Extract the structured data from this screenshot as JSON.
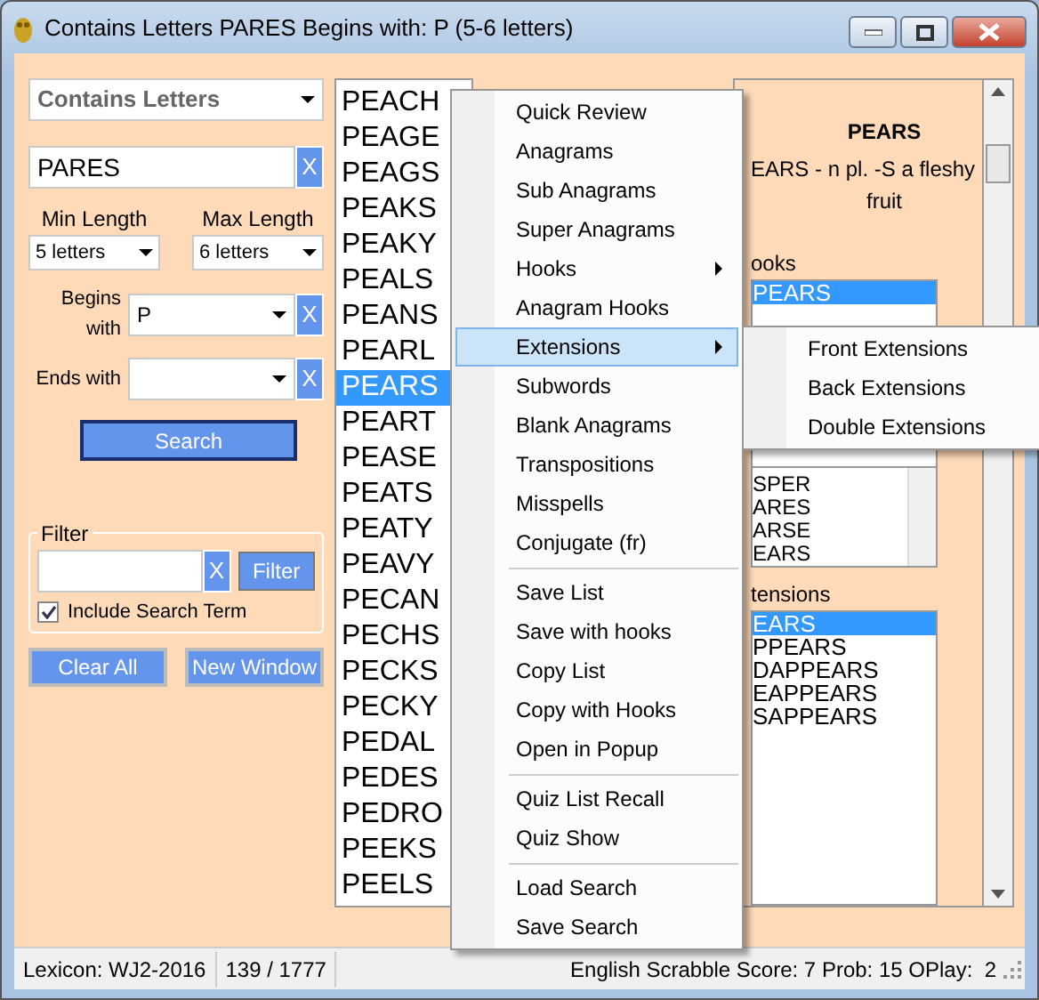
{
  "window": {
    "title": "Contains Letters PARES Begins with: P (5-6 letters)"
  },
  "search": {
    "type": "Contains Letters",
    "letters": "PARES",
    "clear": "X",
    "min_label": "Min Length",
    "min_value": "5 letters",
    "max_label": "Max Length",
    "max_value": "6 letters",
    "begins_label": "Begins with",
    "begins_value": "P",
    "begins_clear": "X",
    "ends_label": "Ends with",
    "ends_clear": "X",
    "button": "Search"
  },
  "filter": {
    "legend": "Filter",
    "clear": "X",
    "button": "Filter",
    "include_label": "Include Search Term",
    "include_checked": true
  },
  "buttons": [
    "Clear All",
    "New Window"
  ],
  "word_list": [
    {
      "word": "PEACH",
      "selected": false
    },
    {
      "word": "PEAGE",
      "selected": false
    },
    {
      "word": "PEAGS",
      "selected": false
    },
    {
      "word": "PEAKS",
      "selected": false
    },
    {
      "word": "PEAKY",
      "selected": false
    },
    {
      "word": "PEALS",
      "selected": false
    },
    {
      "word": "PEANS",
      "selected": false
    },
    {
      "word": "PEARL",
      "selected": false
    },
    {
      "word": "PEARS",
      "selected": true
    },
    {
      "word": "PEART",
      "selected": false
    },
    {
      "word": "PEASE",
      "selected": false
    },
    {
      "word": "PEATS",
      "selected": false
    },
    {
      "word": "PEATY",
      "selected": false
    },
    {
      "word": "PEAVY",
      "selected": false
    },
    {
      "word": "PECAN",
      "selected": false
    },
    {
      "word": "PECHS",
      "selected": false
    },
    {
      "word": "PECKS",
      "selected": false
    },
    {
      "word": "PECKY",
      "selected": false
    },
    {
      "word": "PEDAL",
      "selected": false
    },
    {
      "word": "PEDES",
      "selected": false
    },
    {
      "word": "PEDRO",
      "selected": false
    },
    {
      "word": "PEEKS",
      "selected": false
    },
    {
      "word": "PEELS",
      "selected": false
    }
  ],
  "details": {
    "word": "PEARS",
    "definition": "EARS - n pl. -S a fleshy",
    "definition_2": "fruit",
    "hooks_label": "ooks",
    "hooks": [
      {
        "text": "PEARS",
        "selected": true
      }
    ],
    "anagrams": [
      "SPER",
      "ARES",
      "ARSE",
      "EARS"
    ],
    "extensions_label": "tensions",
    "extensions": [
      {
        "text": "EARS",
        "selected": true
      },
      {
        "text": "PPEARS",
        "selected": false
      },
      {
        "text": "DAPPEARS",
        "selected": false
      },
      {
        "text": "EAPPEARS",
        "selected": false
      },
      {
        "text": "SAPPEARS",
        "selected": false
      }
    ]
  },
  "context_menu": [
    {
      "kind": "item",
      "label": "Quick Review",
      "selected": false
    },
    {
      "kind": "item",
      "label": "Anagrams",
      "selected": false
    },
    {
      "kind": "item",
      "label": "Sub Anagrams",
      "selected": false
    },
    {
      "kind": "item",
      "label": "Super Anagrams",
      "selected": false
    },
    {
      "kind": "submenu",
      "label": "Hooks",
      "selected": false
    },
    {
      "kind": "item",
      "label": "Anagram Hooks",
      "selected": false
    },
    {
      "kind": "submenu",
      "label": "Extensions",
      "selected": true
    },
    {
      "kind": "item",
      "label": "Subwords",
      "selected": false
    },
    {
      "kind": "item",
      "label": "Blank Anagrams",
      "selected": false
    },
    {
      "kind": "item",
      "label": "Transpositions",
      "selected": false
    },
    {
      "kind": "item",
      "label": "Misspells",
      "selected": false
    },
    {
      "kind": "item",
      "label": "Conjugate (fr)",
      "selected": false
    },
    {
      "kind": "separator"
    },
    {
      "kind": "item",
      "label": "Save List",
      "selected": false
    },
    {
      "kind": "item",
      "label": "Save with hooks",
      "selected": false
    },
    {
      "kind": "item",
      "label": "Copy List",
      "selected": false
    },
    {
      "kind": "item",
      "label": "Copy with Hooks",
      "selected": false
    },
    {
      "kind": "item",
      "label": "Open in Popup",
      "selected": false
    },
    {
      "kind": "separator"
    },
    {
      "kind": "item",
      "label": "Quiz List Recall",
      "selected": false
    },
    {
      "kind": "item",
      "label": "Quiz Show",
      "selected": false
    },
    {
      "kind": "separator"
    },
    {
      "kind": "item",
      "label": "Load Search",
      "selected": false
    },
    {
      "kind": "item",
      "label": "Save Search",
      "selected": false
    }
  ],
  "submenu": [
    "Front Extensions",
    "Back Extensions",
    "Double Extensions"
  ],
  "status_bar": {
    "lexicon": "Lexicon: WJ2-2016",
    "count": "139 / 1777",
    "score": "English Scrabble Score: 7 Prob: 15 OPlay:  2"
  }
}
